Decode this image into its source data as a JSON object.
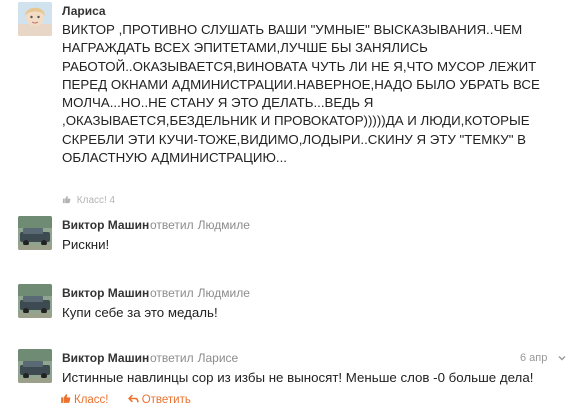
{
  "comments": [
    {
      "author": "Лариса",
      "lines": [
        "ВИКТОР ,ПРОТИВНО СЛУШАТЬ ВАШИ \"УМНЫЕ\" ВЫСКАЗЫВАНИЯ..ЧЕМ",
        "НАГРАЖДАТЬ ВСЕХ ЭПИТЕТАМИ,ЛУЧШЕ БЫ ЗАНЯЛИСЬ",
        "РАБОТОЙ..ОКАЗЫВАЕТСЯ,ВИНОВАТА ЧУТЬ ЛИ НЕ Я,ЧТО МУСОР ЛЕЖИТ",
        "ПЕРЕД ОКНАМИ АДМИНИСТРАЦИИ.НАВЕРНОЕ,НАДО БЫЛО УБРАТЬ ВСЕ",
        "МОЛЧА...НО..НЕ СТАНУ Я ЭТО ДЕЛАТЬ...ВЕДЬ Я",
        ",ОКАЗЫВАЕТСЯ,БЕЗДЕЛЬНИК И ПРОВОКАТОР)))))ДА И ЛЮДИ,КОТОРЫЕ",
        "СКРЕБЛИ ЭТИ КУЧИ-ТОЖЕ,ВИДИМО,ЛОДЫРИ..СКИНУ Я ЭТУ \"ТЕМКУ\" В",
        "ОБЛАСТНУЮ АДМИНИСТРАЦИЮ..."
      ],
      "klass_label": "Класс! 4"
    },
    {
      "author": "Виктор Машин",
      "reply_word": "ответил",
      "reply_to": "Людмиле",
      "text": "Рискни!"
    },
    {
      "author": "Виктор Машин",
      "reply_word": "ответил",
      "reply_to": "Людмиле",
      "text": "Купи себе за это медаль!"
    },
    {
      "author": "Виктор Машин",
      "reply_word": "ответил",
      "reply_to": "Ларисе",
      "date": "6 апр",
      "text": "Истинные навлинцы сор из избы не выносят! Меньше слов -0 больше дела!",
      "actions": {
        "klass": "Класс!",
        "reply": "Ответить"
      }
    }
  ],
  "colors": {
    "accent": "#eb722e",
    "muted": "#8c8c8c"
  }
}
